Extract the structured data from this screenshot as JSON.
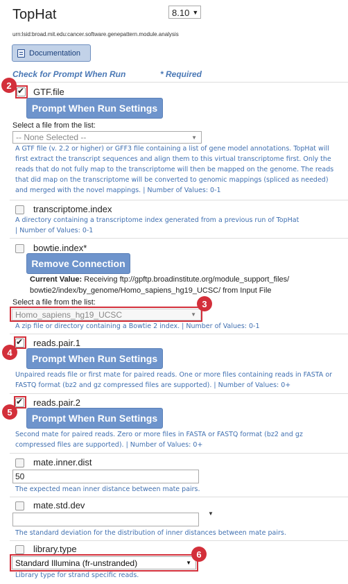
{
  "header": {
    "title": "TopHat",
    "version": "8.10",
    "lsid": "urn:lsid:broad.mit.edu:cancer.software.genepattern.module.analysis",
    "documentation_label": "Documentation"
  },
  "legend": {
    "prompt": "Check for Prompt When Run",
    "required": "* Required"
  },
  "callouts": [
    "2",
    "3",
    "4",
    "5",
    "6"
  ],
  "params": {
    "gtf": {
      "name": "GTF.file",
      "button": "Prompt When Run Settings",
      "select_label": "Select a file from the list:",
      "select_value": "-- None Selected --",
      "desc": [
        "A GTF file (v. 2.2 or higher) or GFF3 file containing a list of gene model annotations. TopHat will",
        "first extract the transcript sequences and align them to this virtual transcriptome first. Only the",
        "reads that do not fully map to the transcriptome will then be mapped on the genome. The reads",
        "that did map on the transcriptome will be converted to genomic mappings (spliced as needed)",
        "and merged with the novel mappings. |  Number of Values: 0-1"
      ]
    },
    "transcriptome": {
      "name": "transcriptome.index",
      "desc": [
        "A directory containing a transcriptome index  generated from a previous run of TopHat",
        " |  Number of Values: 0-1"
      ]
    },
    "bowtie": {
      "name": "bowtie.index*",
      "button": "Remove Connection",
      "current_label": "Current Value:",
      "current_value_1": " Receiving  ftp://gpftp.broadinstitute.org/module_support_files/",
      "current_value_2": "bowtie2/index/by_genome/Homo_sapiens_hg19_UCSC/  from Input File",
      "select_label": "Select a file from the list:",
      "select_value": "Homo_sapiens_hg19_UCSC",
      "desc": [
        "A zip file or directory containing a Bowtie 2 index.  |  Number of Values: 0-1"
      ]
    },
    "pair1": {
      "name": "reads.pair.1",
      "button": "Prompt When Run Settings",
      "desc": [
        "Unpaired reads file or first mate for paired reads. One or more files containing reads in FASTA or",
        "FASTQ format (bz2 and gz compressed files are supported).  |  Number of Values: 0+"
      ]
    },
    "pair2": {
      "name": "reads.pair.2",
      "button": "Prompt When Run Settings",
      "desc": [
        "Second mate for paired reads. Zero or more files in FASTA or FASTQ format (bz2 and gz",
        "compressed files are supported).  |  Number of Values: 0+"
      ]
    },
    "inner": {
      "name": "mate.inner.dist",
      "value": "50",
      "desc": [
        "The expected mean inner distance between mate pairs."
      ]
    },
    "stddev": {
      "name": "mate.std.dev",
      "value": "",
      "desc": [
        "The standard deviation for the distribution of inner distances between mate pairs."
      ]
    },
    "libtype": {
      "name": "library.type",
      "select_value": "Standard Illumina (fr-unstranded)",
      "desc": [
        "Library type for strand specific reads."
      ]
    }
  }
}
